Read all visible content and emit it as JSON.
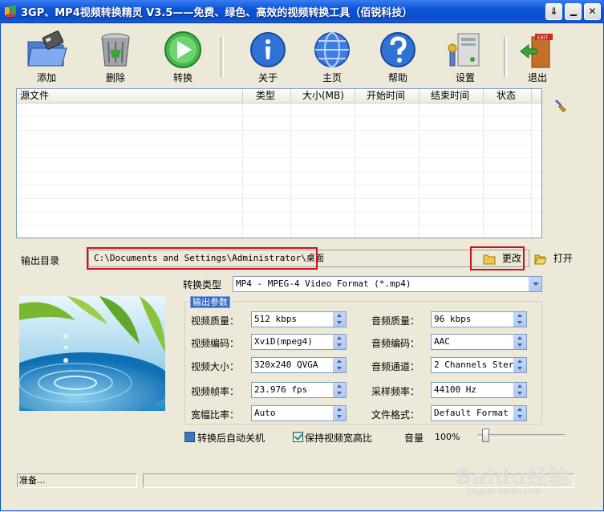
{
  "window": {
    "title": "3GP、MP4视频转换精灵 V3.5——免费、绿色、高效的视频转换工具（佰锐科技）",
    "controls": [
      "⇓",
      "",
      "✕"
    ]
  },
  "toolbar": {
    "add": "添加",
    "delete": "删除",
    "convert": "转换",
    "about": "关于",
    "home": "主页",
    "help": "帮助",
    "settings": "设置",
    "exit": "退出"
  },
  "file_list": {
    "columns": [
      "源文件",
      "类型",
      "大小(MB)",
      "开始时间",
      "结束时间",
      "状态"
    ],
    "rows": []
  },
  "output": {
    "label": "输出目录",
    "path": "C:\\Documents and Settings\\Administrator\\桌面",
    "change_button": "更改",
    "open_button": "打开"
  },
  "convert_type": {
    "label": "转换类型",
    "value": "MP4 - MPEG-4 Video Format (*.mp4)"
  },
  "output_params": {
    "legend": "输出参数",
    "video_quality_label": "视频质量：",
    "video_quality": "512 kbps",
    "video_codec_label": "视频编码：",
    "video_codec": "XviD(mpeg4)",
    "video_size_label": "视频大小：",
    "video_size": "320x240 QVGA",
    "video_fps_label": "视频帧率：",
    "video_fps": "23.976 fps",
    "aspect_label": "宽幅比率：",
    "aspect": "Auto",
    "audio_quality_label": "音频质量：",
    "audio_quality": "96  kbps",
    "audio_codec_label": "音频编码：",
    "audio_codec": "AAC",
    "audio_channels_label": "音频通道：",
    "audio_channels": "2 Channels Stere",
    "sample_rate_label": "采样频率：",
    "sample_rate": "44100 Hz",
    "file_format_label": "文件格式：",
    "file_format": "Default Format"
  },
  "options": {
    "auto_shutdown": "转换后自动关机",
    "auto_shutdown_checked": false,
    "keep_aspect": "保持视频宽高比",
    "keep_aspect_checked": true,
    "volume_label": "音量",
    "volume_value": "100%",
    "volume_fraction": 0.05
  },
  "status": {
    "text": "准备..."
  },
  "watermark": {
    "text": "Baidu经验",
    "sub": "jingyan.baidu.com"
  },
  "colors": {
    "title_bar": "#0b4ec8",
    "highlight_box": "#d0101a"
  }
}
